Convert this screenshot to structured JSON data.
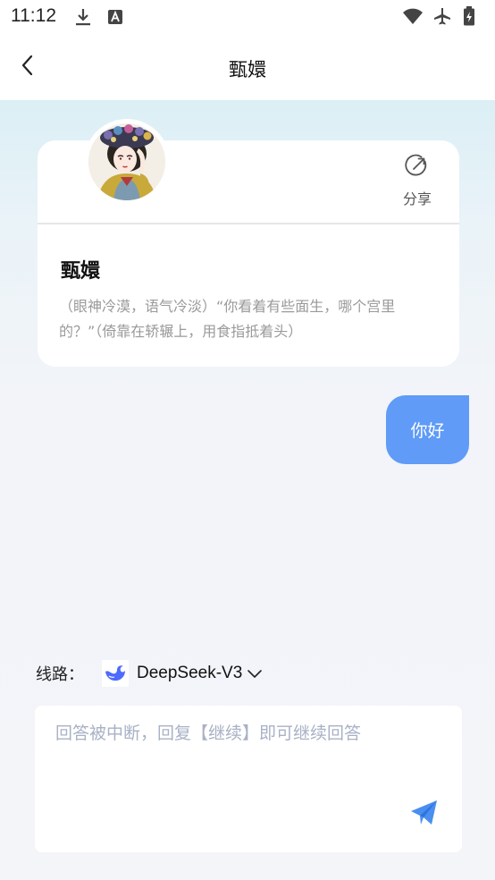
{
  "status_bar": {
    "time": "11:12",
    "left_icons": [
      "download-icon",
      "font-a-icon"
    ],
    "right_icons": [
      "wifi-icon",
      "airplane-icon",
      "battery-charging-icon"
    ]
  },
  "header": {
    "title": "甄嬛",
    "back_icon": "chevron-left-icon"
  },
  "character_card": {
    "name": "甄嬛",
    "description": "（眼神冷漠，语气冷淡）“你看着有些面生，哪个宫里的？”（倚靠在轿辗上，用食指抵着头）",
    "share_label": "分享",
    "share_icon": "share-icon"
  },
  "messages": [
    {
      "role": "user",
      "text": "你好"
    }
  ],
  "route": {
    "label": "线路：",
    "model": "DeepSeek-V3",
    "model_icon": "deepseek-whale-icon"
  },
  "input": {
    "placeholder": "回答被中断，回复【继续】即可继续回答",
    "send_icon": "send-icon"
  },
  "colors": {
    "accent": "#5f9bf7",
    "send": "#4a8ff0",
    "placeholder": "#a9b1c6"
  }
}
